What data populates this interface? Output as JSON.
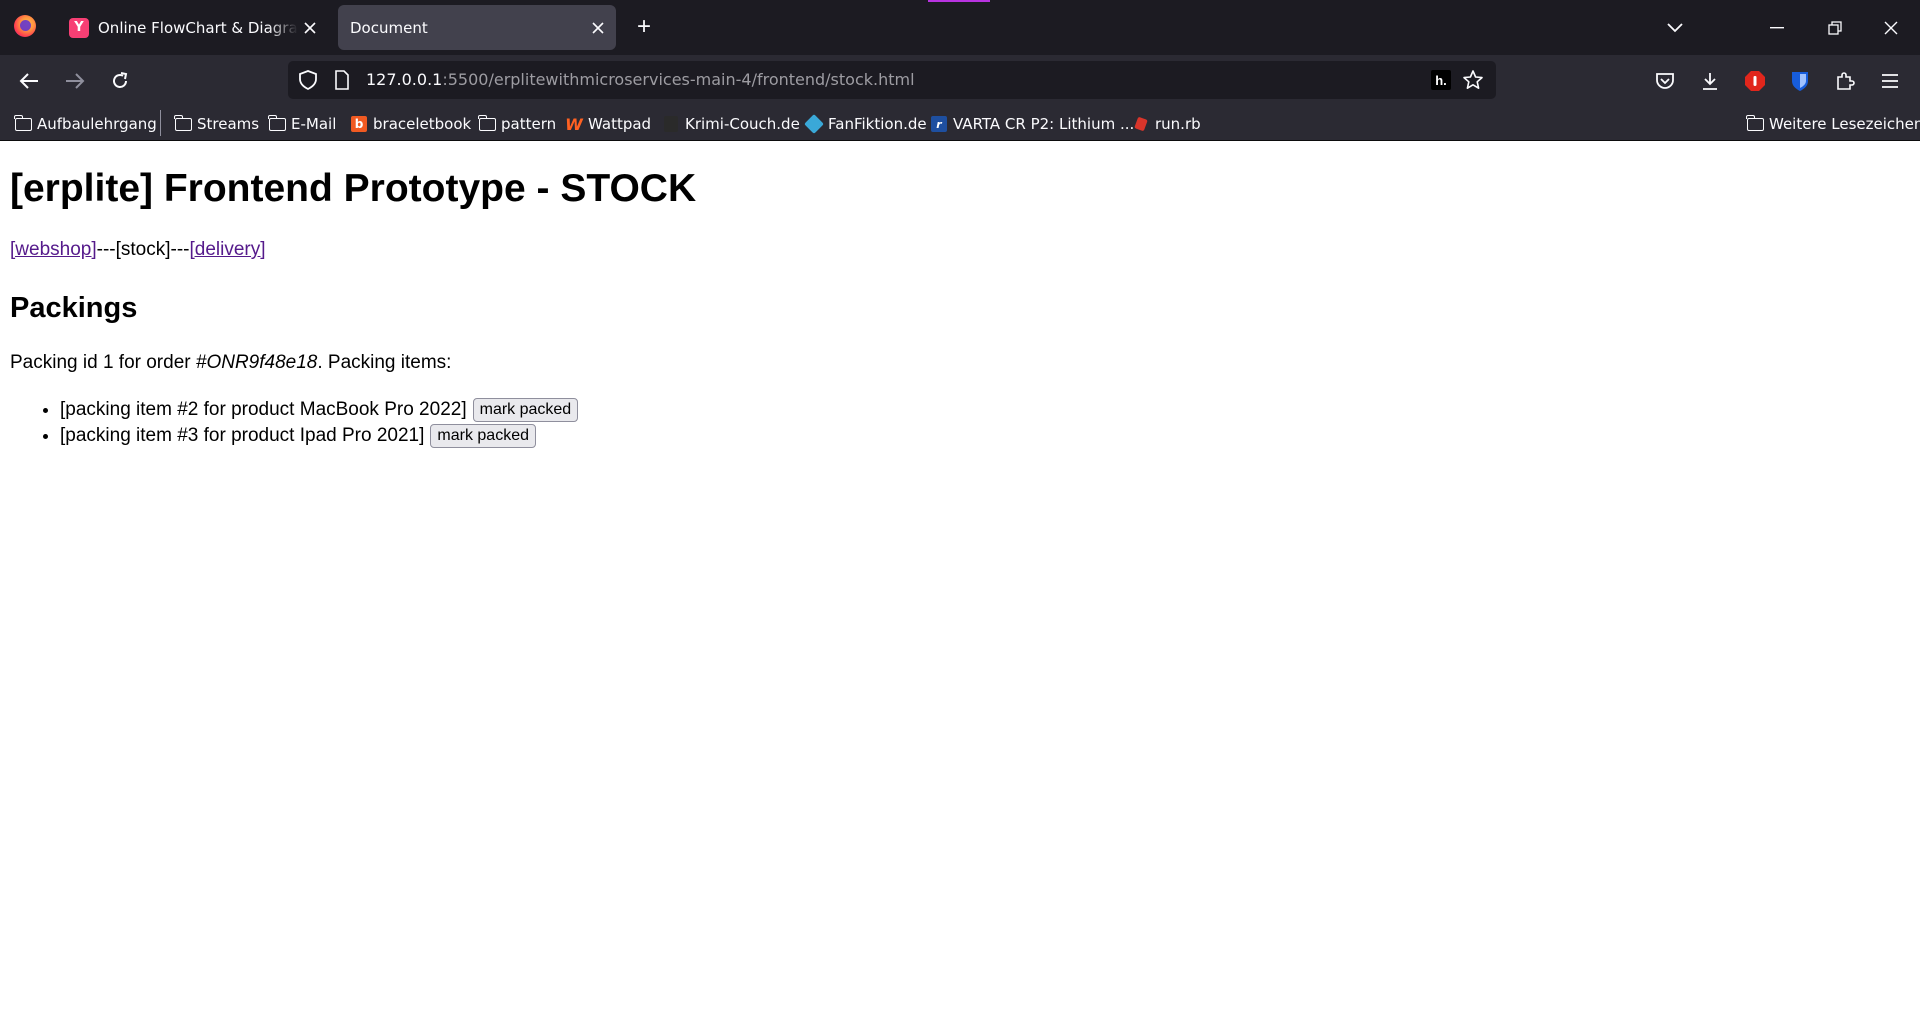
{
  "browser": {
    "tabs": [
      {
        "title": "Online FlowChart & Diagrams Editor - Mermaid Live Editor",
        "favicon": "mermaid-icon",
        "active": false
      },
      {
        "title": "Document",
        "favicon": "",
        "active": true
      }
    ],
    "url": {
      "host": "127.0.0.1",
      "rest": ":5500/erplitewithmicroservices-main-4/frontend/stock.html"
    },
    "bookmarks": [
      {
        "label": "Aufbaulehrgang",
        "icon": "folder-icon"
      },
      {
        "label": "Streams",
        "icon": "folder-icon"
      },
      {
        "label": "E-Mail",
        "icon": "folder-icon"
      },
      {
        "label": "braceletbook",
        "icon": "braceletbook-icon"
      },
      {
        "label": "pattern",
        "icon": "folder-icon"
      },
      {
        "label": "Wattpad",
        "icon": "wattpad-icon"
      },
      {
        "label": "Krimi-Couch.de",
        "icon": "krimi-couch-icon"
      },
      {
        "label": "FanFiktion.de",
        "icon": "fanfiktion-icon"
      },
      {
        "label": "VARTA CR P2: Lithium ...",
        "icon": "varta-icon"
      },
      {
        "label": "run.rb",
        "icon": "ruby-icon"
      }
    ],
    "other_bookmarks": "Weitere Lesezeichen"
  },
  "page": {
    "title": "[erplite] Frontend Prototype - STOCK",
    "nav": {
      "webshop": "[webshop]",
      "sep1": "---",
      "current": "[stock]",
      "sep2": "---",
      "delivery": "[delivery]"
    },
    "section_title": "Packings",
    "packing": {
      "prefix": "Packing id 1 for order ",
      "order": "#ONR9f48e18",
      "suffix": ". Packing items:"
    },
    "items": [
      {
        "text": "[packing item #2 for product MacBook Pro 2022]",
        "button": "mark packed"
      },
      {
        "text": "[packing item #3 for product Ipad Pro 2021]",
        "button": "mark packed"
      }
    ]
  }
}
